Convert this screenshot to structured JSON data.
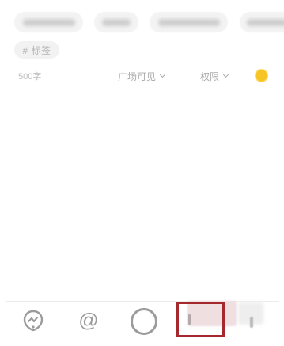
{
  "suggestion_chips": [
    {
      "label": ""
    },
    {
      "label": ""
    },
    {
      "label": ""
    },
    {
      "label": ""
    }
  ],
  "topic_tag": {
    "label": "# 标签"
  },
  "meta": {
    "char_count": "500字",
    "visibility_dropdown": "广场可见",
    "permission_dropdown": "权限",
    "emoji_color": "#f7c426"
  },
  "toolbar": {
    "items": [
      {
        "icon": "topic-icon"
      },
      {
        "icon": "mention-icon",
        "glyph": "@"
      },
      {
        "icon": "circle-icon"
      },
      {
        "icon": "hidden-tool-icon"
      },
      {
        "icon": "hidden-tool-icon"
      }
    ],
    "highlight_color": "#a5282c"
  }
}
